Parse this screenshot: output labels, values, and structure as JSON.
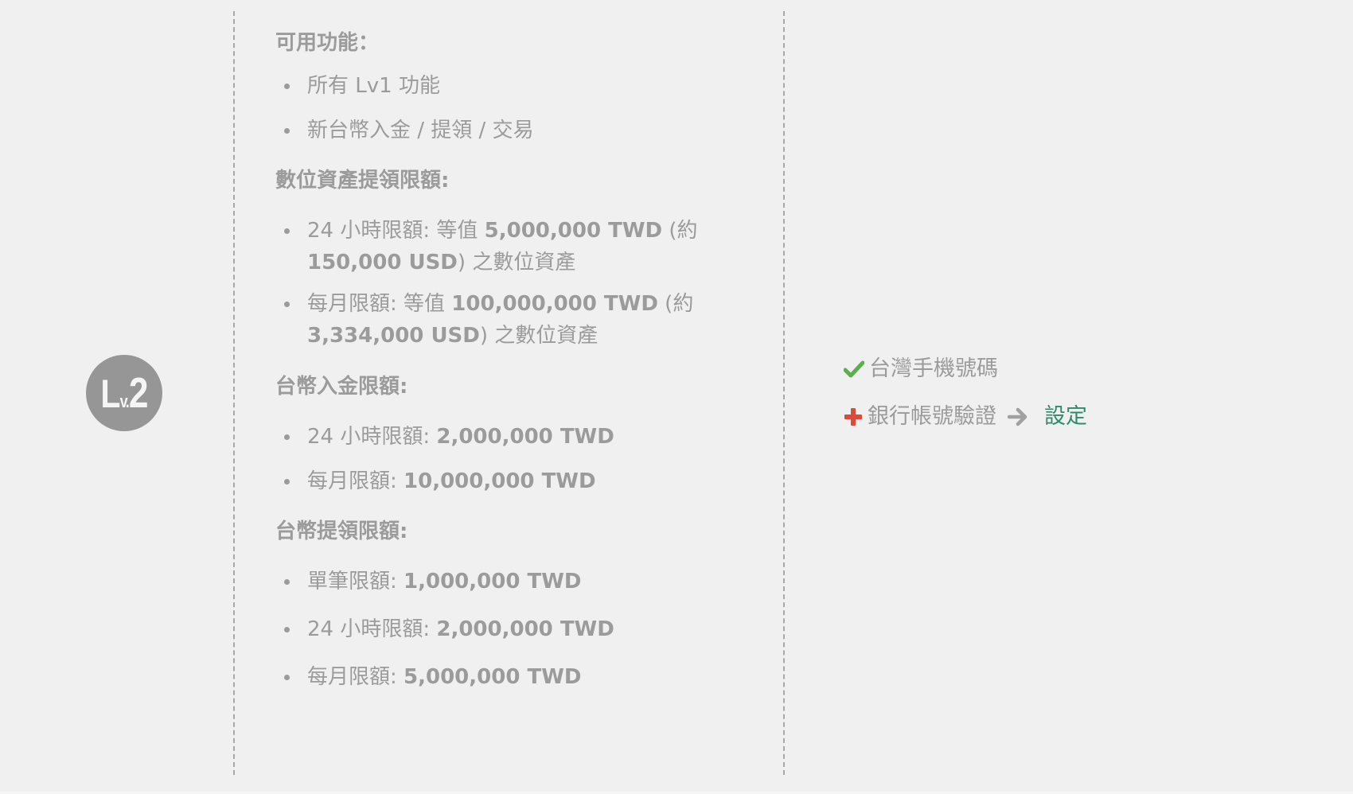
{
  "badge": {
    "letter_l": "L",
    "letter_v": "v.",
    "number": "2"
  },
  "features": {
    "title": "可用功能：",
    "items": [
      {
        "text": "所有 Lv1 功能"
      },
      {
        "text": "新台幣入金 / 提領 / 交易"
      }
    ]
  },
  "crypto_limits": {
    "title": "數位資產提領限額:",
    "items": [
      {
        "prefix": "24 小時限額: 等值 ",
        "amount": "5,000,000 TWD",
        "mid": " (約 ",
        "amount2": "150,000 USD",
        "suffix": ") 之數位資產"
      },
      {
        "prefix": "每月限額: 等值 ",
        "amount": "100,000,000 TWD",
        "mid": " (約 ",
        "amount2": "3,334,000 USD",
        "suffix": ") 之數位資產"
      }
    ]
  },
  "twd_deposit": {
    "title": "台幣入金限額:",
    "items": [
      {
        "label": "24 小時限額: ",
        "amount": "2,000,000 TWD"
      },
      {
        "label": "每月限額: ",
        "amount": "10,000,000 TWD"
      }
    ]
  },
  "twd_withdraw": {
    "title": "台幣提領限額:",
    "items": [
      {
        "label": "單筆限額: ",
        "amount": "1,000,000 TWD"
      },
      {
        "label": "24 小時限額: ",
        "amount": "2,000,000 TWD"
      },
      {
        "label": "每月限額: ",
        "amount": "5,000,000 TWD"
      }
    ]
  },
  "requirements": {
    "phone": {
      "label": "台灣手機號碼",
      "status": "done"
    },
    "bank": {
      "label": "銀行帳號驗證",
      "status": "missing",
      "action": "設定"
    }
  },
  "colors": {
    "check": "#5cae4f",
    "plus": "#de4a3a",
    "link": "#2e8c6d",
    "badge": "#969696"
  }
}
